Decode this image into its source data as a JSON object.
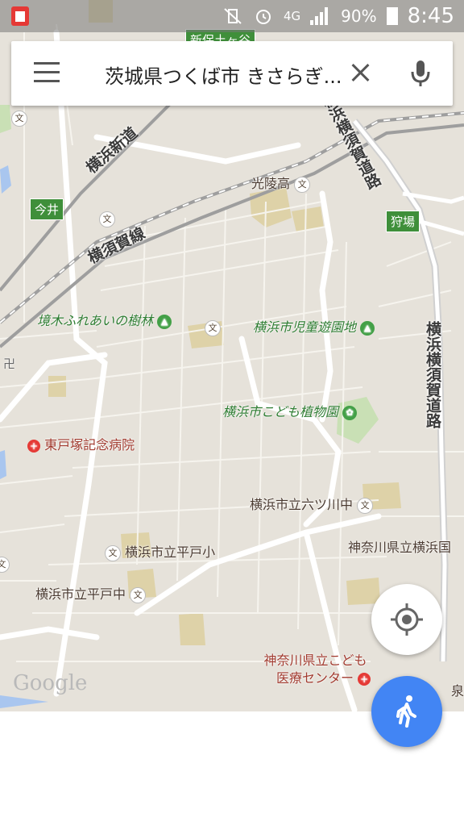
{
  "status_bar": {
    "network": "4G",
    "battery": "90%",
    "time": "8:45"
  },
  "search": {
    "query": "茨城県つくば市 きさらぎ..."
  },
  "map": {
    "roads": {
      "yokohama_shindo": "横浜新道",
      "yokosuka_line": "横須賀線",
      "yokohama_yokosuka_road_top": "横浜横須賀道路",
      "yokohama_yokosuka_road_right": "横浜横須賀道路"
    },
    "interchanges": {
      "imai": "今井",
      "kariba": "狩場",
      "shinhodogaya": "新保土ヶ谷"
    },
    "parks": {
      "sakaiki": "境木ふれあいの樹林",
      "jido_yuenchi": "横浜市児童遊園地",
      "kodomo_shokubutsuen": "横浜市こども植物園"
    },
    "schools": {
      "koryo": "光陵高",
      "mutsukawa": "横浜市立六ツ川中",
      "hirado_sho": "横浜市立平戸小",
      "hirado_chu": "横浜市立平戸中",
      "kanagawa_yokohama": "神奈川県立横浜国",
      "school_icon": "文"
    },
    "hospitals": {
      "higashi_totsuka": "東戸塚記念病院",
      "kodomo_iryo_1": "神奈川県立こども",
      "kodomo_iryo_2": "医療センター",
      "izumi": "泉"
    },
    "misc": {
      "temple": "卍",
      "edge_bun": "文"
    },
    "google_logo": "Google"
  },
  "icons": {
    "menu": "menu-icon",
    "clear": "close-icon",
    "mic": "microphone-icon",
    "location": "my-location-icon",
    "walk": "walking-icon"
  }
}
